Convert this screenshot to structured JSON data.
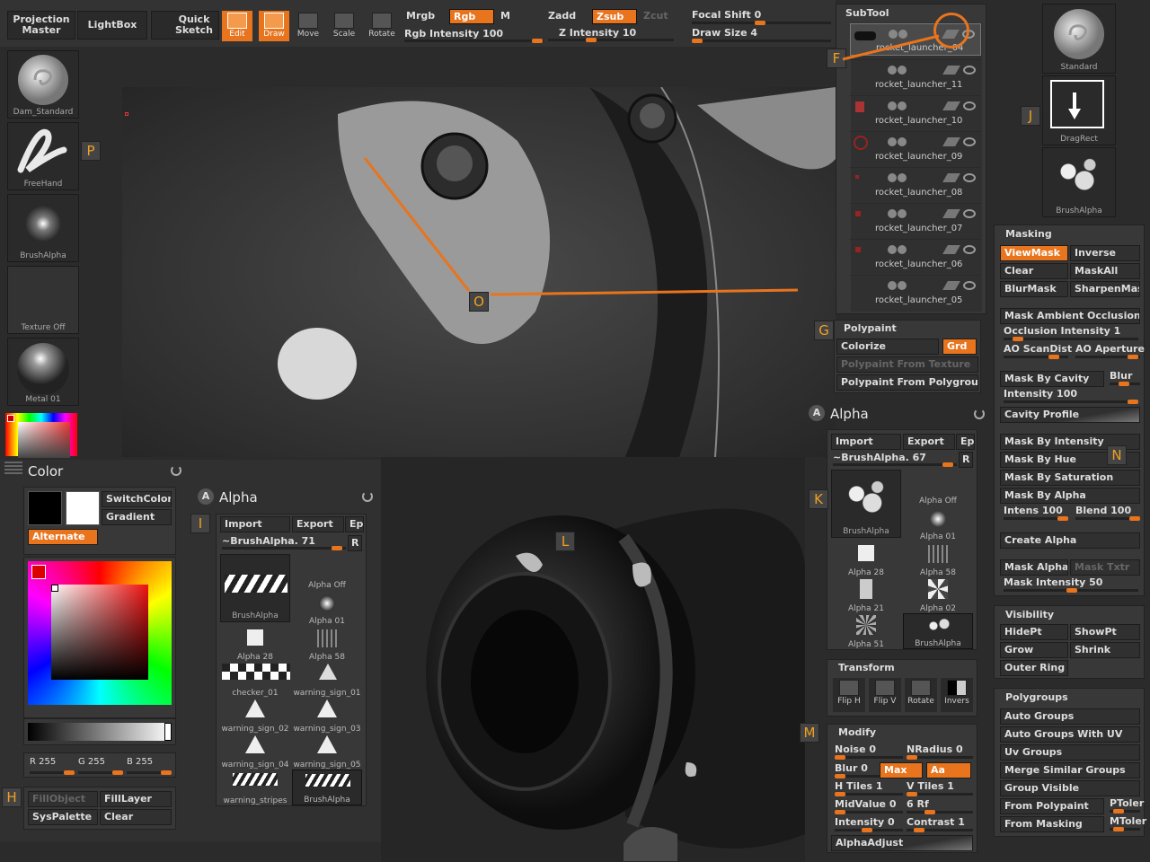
{
  "toolbar": {
    "projection_master": "Projection\nMaster",
    "lightbox": "LightBox",
    "quick_sketch": "Quick\nSketch",
    "edit": "Edit",
    "draw": "Draw",
    "move": "Move",
    "scale": "Scale",
    "rotate": "Rotate",
    "mrgb": "Mrgb",
    "rgb": "Rgb",
    "m": "M",
    "rgb_intensity": "Rgb  Intensity 100",
    "zadd": "Zadd",
    "zsub": "Zsub",
    "zcut": "Zcut",
    "z_intensity": "Z  Intensity 10",
    "focal_shift": "Focal  Shift 0",
    "draw_size": "Draw  Size 4"
  },
  "left_shelf": {
    "brush": "Dam_Standard",
    "stroke": "FreeHand",
    "alpha": "BrushAlpha",
    "texture": "Texture  Off",
    "material": "Metal  01"
  },
  "color_panel": {
    "title": "Color",
    "switch_color": "SwitchColor",
    "gradient": "Gradient",
    "alternate": "Alternate",
    "r": "R 255",
    "g": "G 255",
    "b": "B 255",
    "fill_object": "FillObject",
    "fill_layer": "FillLayer",
    "sys_palette": "SysPalette",
    "clear": "Clear"
  },
  "alpha_panel_left": {
    "title": "Alpha",
    "import": "Import",
    "export": "Export",
    "ep": "Ep",
    "current": "~BrushAlpha. 71",
    "r": "R",
    "items": [
      "BrushAlpha",
      "Alpha  Off",
      "Alpha  01",
      "Alpha  28",
      "Alpha  58",
      "checker_01",
      "warning_sign_01",
      "warning_sign_02",
      "warning_sign_03",
      "warning_sign_04",
      "warning_sign_05",
      "warning_stripes",
      "BrushAlpha"
    ]
  },
  "subtool": {
    "title": "SubTool",
    "items": [
      "rocket_launcher_04",
      "rocket_launcher_11",
      "rocket_launcher_10",
      "rocket_launcher_09",
      "rocket_launcher_08",
      "rocket_launcher_07",
      "rocket_launcher_06",
      "rocket_launcher_05"
    ]
  },
  "polypaint": {
    "title": "Polypaint",
    "colorize": "Colorize",
    "grd": "Grd",
    "from_texture": "Polypaint  From  Texture",
    "from_polygroup": "Polypaint  From  Polygroup"
  },
  "alpha_panel_right": {
    "title": "Alpha",
    "import": "Import",
    "export": "Export",
    "ep": "Ep",
    "current": "~BrushAlpha. 67",
    "r": "R",
    "items": [
      "BrushAlpha",
      "Alpha  Off",
      "Alpha  01",
      "Alpha  28",
      "Alpha  58",
      "Alpha  21",
      "Alpha  02",
      "Alpha  51",
      "BrushAlpha"
    ],
    "transform_title": "Transform",
    "flip_h": "Flip H",
    "flip_v": "Flip V",
    "rotate": "Rotate",
    "invers": "Invers",
    "modify_title": "Modify",
    "noise": "Noise 0",
    "nradius": "NRadius 0",
    "blur": "Blur 0",
    "max": "Max",
    "aa": "Aa",
    "h_tiles": "H  Tiles 1",
    "v_tiles": "V  Tiles 1",
    "midvalue": "MidValue 0",
    "rf": "6 Rf",
    "intensity": "Intensity 0",
    "contrast": "Contrast 1",
    "alpha_adjust": "AlphaAdjust"
  },
  "right_shelf": {
    "standard": "Standard",
    "dragrect": "DragRect",
    "brushalpha": "BrushAlpha"
  },
  "masking": {
    "title": "Masking",
    "viewmask": "ViewMask",
    "inverse": "Inverse",
    "clear": "Clear",
    "maskall": "MaskAll",
    "blurmask": "BlurMask",
    "sharpenmask": "SharpenMask",
    "ambient_occlusion": "Mask  Ambient  Occlusion",
    "occlusion_intensity": "Occlusion  Intensity 1",
    "ao_scandist": "AO  ScanDist",
    "ao_aperture": "AO  Aperture",
    "mask_by_cavity": "Mask  By  Cavity",
    "blur": "Blur",
    "intensity_100": "Intensity 100",
    "cavity_profile": "Cavity  Profile",
    "mask_by_intensity": "Mask  By  Intensity",
    "mask_by_hue": "Mask  By  Hue",
    "mask_by_saturation": "Mask  By  Saturation",
    "mask_by_alpha": "Mask  By  Alpha",
    "intens_100": "Intens 100",
    "blend_100": "Blend 100",
    "create_alpha": "Create  Alpha",
    "mask_alpha": "Mask  Alpha",
    "mask_txtr": "Mask  Txtr",
    "mask_intensity": "Mask  Intensity 50"
  },
  "visibility": {
    "title": "Visibility",
    "hidept": "HidePt",
    "showpt": "ShowPt",
    "grow": "Grow",
    "shrink": "Shrink",
    "outer_ring": "Outer  Ring"
  },
  "polygroups": {
    "title": "Polygroups",
    "auto_groups": "Auto  Groups",
    "auto_groups_uv": "Auto  Groups  With  UV",
    "uv_groups": "Uv  Groups",
    "merge_similar": "Merge  Similar  Groups",
    "group_visible": "Group  Visible",
    "from_polypaint": "From  Polypaint",
    "ptoler": "PToler",
    "from_masking": "From  Masking",
    "mtoler": "MToler"
  },
  "callouts": {
    "F": "F",
    "G": "G",
    "H": "H",
    "I": "I",
    "J": "J",
    "K": "K",
    "L": "L",
    "M": "M",
    "N": "N",
    "O": "O",
    "P": "P"
  },
  "colors": {
    "accent": "#e8741d",
    "callout_text": "#f0a020",
    "panel": "#383838",
    "background": "#2b2b2b"
  }
}
